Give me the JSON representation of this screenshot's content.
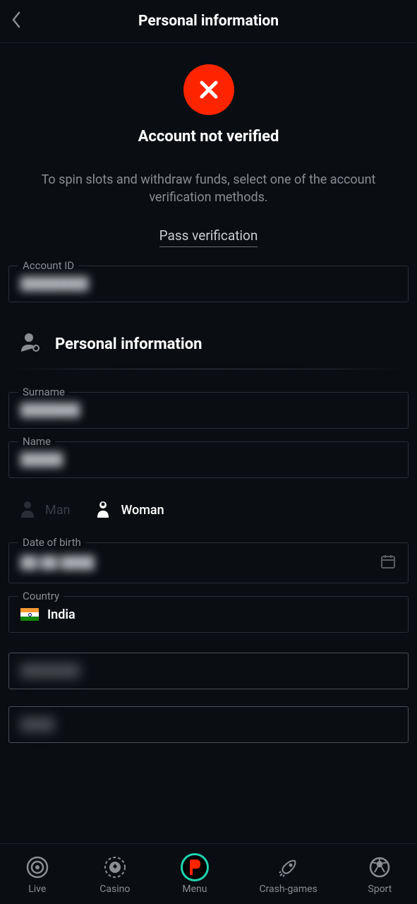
{
  "header": {
    "title": "Personal information"
  },
  "status": {
    "title": "Account not verified",
    "description": "To spin slots and withdraw funds, select one of the account verification methods.",
    "link_label": "Pass verification"
  },
  "fields": {
    "account_id": {
      "label": "Account ID",
      "value": "████████"
    },
    "surname": {
      "label": "Surname",
      "value": "███████"
    },
    "name": {
      "label": "Name",
      "value": "█████"
    },
    "dob": {
      "label": "Date of birth",
      "value": "██ ██ ████"
    },
    "country": {
      "label": "Country",
      "value": "India"
    },
    "region": {
      "value": "███████"
    },
    "city": {
      "value": "████"
    }
  },
  "section": {
    "title": "Personal information"
  },
  "gender": {
    "man": "Man",
    "woman": "Woman",
    "selected": "woman"
  },
  "nav": {
    "live": "Live",
    "casino": "Casino",
    "menu": "Menu",
    "crash": "Crash-games",
    "sport": "Sport"
  }
}
